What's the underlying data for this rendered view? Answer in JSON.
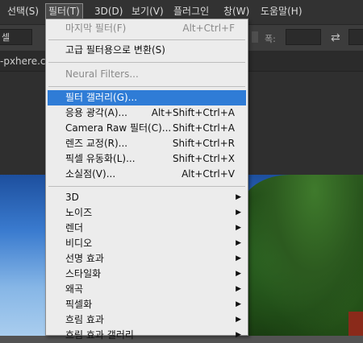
{
  "menubar": {
    "items": [
      "선택(S)",
      "필터(T)",
      "3D(D)",
      "보기(V)",
      "플러그인",
      "창(W)",
      "도움말(H)"
    ]
  },
  "options_bar": {
    "select_value": "셀",
    "width_label": "폭:",
    "swap_icon": "swap-arrows-icon"
  },
  "document_tab": {
    "label": "-pxhere.co"
  },
  "filter_menu": {
    "items": [
      {
        "label": "마지막 필터(F)",
        "shortcut": "Alt+Ctrl+F",
        "disabled": true
      },
      {
        "label": "고급 필터용으로 변환(S)",
        "shortcut": ""
      },
      {
        "label": "Neural Filters...",
        "shortcut": "",
        "disabled": true
      },
      {
        "label": "필터 갤러리(G)...",
        "shortcut": "",
        "highlighted": true
      },
      {
        "label": "응용 광각(A)...",
        "shortcut": "Alt+Shift+Ctrl+A"
      },
      {
        "label": "Camera Raw 필터(C)...",
        "shortcut": "Shift+Ctrl+A"
      },
      {
        "label": "렌즈 교정(R)...",
        "shortcut": "Shift+Ctrl+R"
      },
      {
        "label": "픽셀 유동화(L)...",
        "shortcut": "Shift+Ctrl+X"
      },
      {
        "label": "소실점(V)...",
        "shortcut": "Alt+Ctrl+V"
      },
      {
        "label": "3D",
        "submenu": true
      },
      {
        "label": "노이즈",
        "submenu": true
      },
      {
        "label": "렌더",
        "submenu": true
      },
      {
        "label": "비디오",
        "submenu": true
      },
      {
        "label": "선명 효과",
        "submenu": true
      },
      {
        "label": "스타일화",
        "submenu": true
      },
      {
        "label": "왜곡",
        "submenu": true
      },
      {
        "label": "픽셀화",
        "submenu": true
      },
      {
        "label": "흐림 효과",
        "submenu": true
      },
      {
        "label": "흐림 효과 갤러리",
        "submenu": true
      }
    ],
    "submenu_arrow": "▶"
  }
}
